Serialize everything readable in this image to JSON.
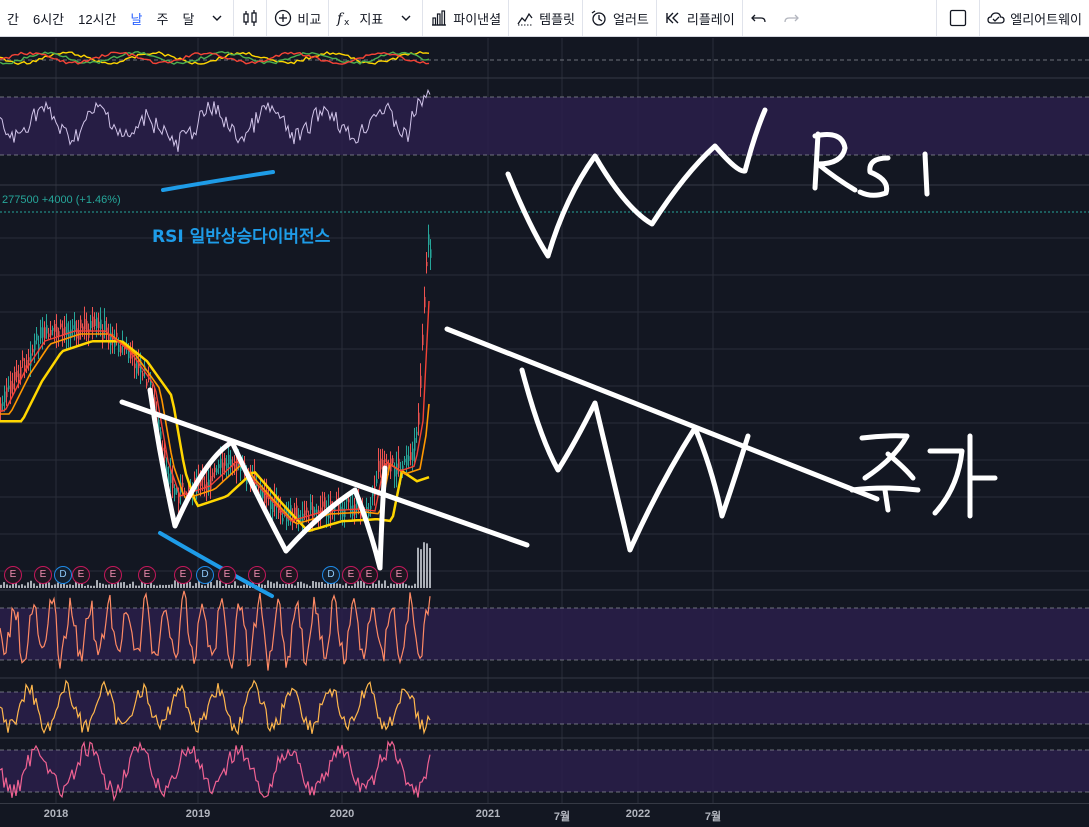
{
  "toolbar": {
    "intervals": [
      "간",
      "6시간",
      "12시간",
      "날",
      "주",
      "달"
    ],
    "active_interval": "날",
    "compare_label": "비교",
    "indicators_label": "지표",
    "financials_label": "파이낸셜",
    "templates_label": "템플릿",
    "alert_label": "얼러트",
    "replay_label": "리플레이",
    "alert_right_label": "엘리어트웨이"
  },
  "price": {
    "last": "277500",
    "change": "+4000",
    "change_pct": "(+1.46%)"
  },
  "annotations": {
    "divergence_label": "RSI 일반상승다이버전스"
  },
  "events": {
    "badges": [
      "E",
      "E",
      "D",
      "E",
      "E",
      "E",
      "E",
      "D",
      "E",
      "E",
      "E",
      "D",
      "E",
      "E",
      "E"
    ]
  },
  "time_axis": {
    "labels": [
      "2018",
      "2019",
      "2020",
      "2021",
      "7월",
      "2022",
      "7월"
    ]
  },
  "colors": {
    "background": "#131722",
    "rsi_band": "#2a1e4a",
    "up_candle": "#26a69a",
    "down_candle": "#ef5350",
    "ma_yellow": "#ffd600",
    "ma_orange": "#ff9800",
    "ma_red": "#f44336",
    "rsi_line": "#d1c4e9",
    "divergence_line": "#1e9ce8",
    "accent": "#2962ff"
  }
}
